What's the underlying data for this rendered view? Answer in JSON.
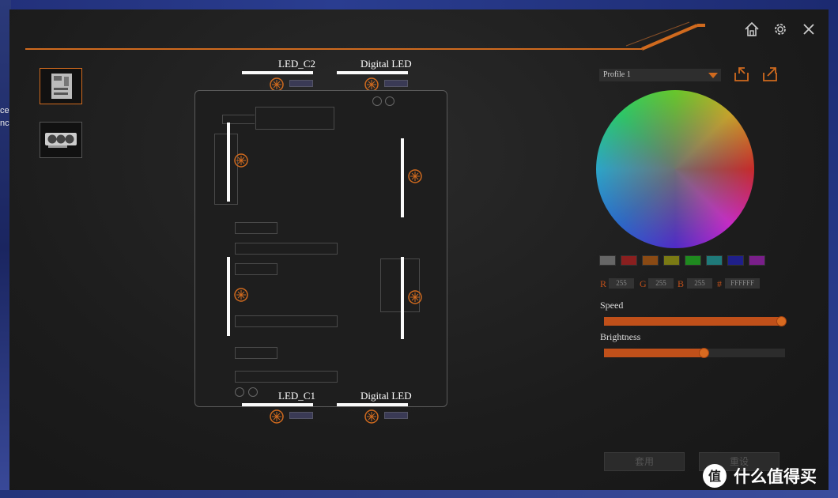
{
  "desktop": {
    "left_text_1": "ce",
    "left_text_2": "nc"
  },
  "header": {
    "home_icon": "home-icon",
    "settings_icon": "gear-icon",
    "close_icon": "close-icon",
    "accent": "#d06a1e"
  },
  "sidebar": {
    "items": [
      {
        "name": "motherboard",
        "icon": "motherboard-icon",
        "active": true
      },
      {
        "name": "graphics-card",
        "icon": "graphics-card-icon",
        "active": false
      }
    ]
  },
  "board": {
    "connectors": {
      "top_left": "LED_C2",
      "top_right": "Digital LED",
      "bottom_left": "LED_C1",
      "bottom_right": "Digital LED"
    }
  },
  "panel": {
    "profile": {
      "selected": "Profile 1"
    },
    "swatches": [
      "#666666",
      "#8a1f1f",
      "#8a4a14",
      "#7a7a14",
      "#1f8a1f",
      "#1f7a7a",
      "#1f1f8a",
      "#7a1f8a"
    ],
    "rgb": {
      "r_label": "R",
      "r": "255",
      "g_label": "G",
      "g": "255",
      "b_label": "B",
      "b": "255",
      "hex_label": "#",
      "hex": "FFFFFF"
    },
    "speed": {
      "label": "Speed",
      "value": 0.98
    },
    "brightness": {
      "label": "Brightness",
      "value": 0.55
    },
    "apply_label": "套用",
    "reset_label": "重设"
  },
  "watermark": {
    "text": "什么值得买",
    "icon": "zhi-logo-icon"
  }
}
